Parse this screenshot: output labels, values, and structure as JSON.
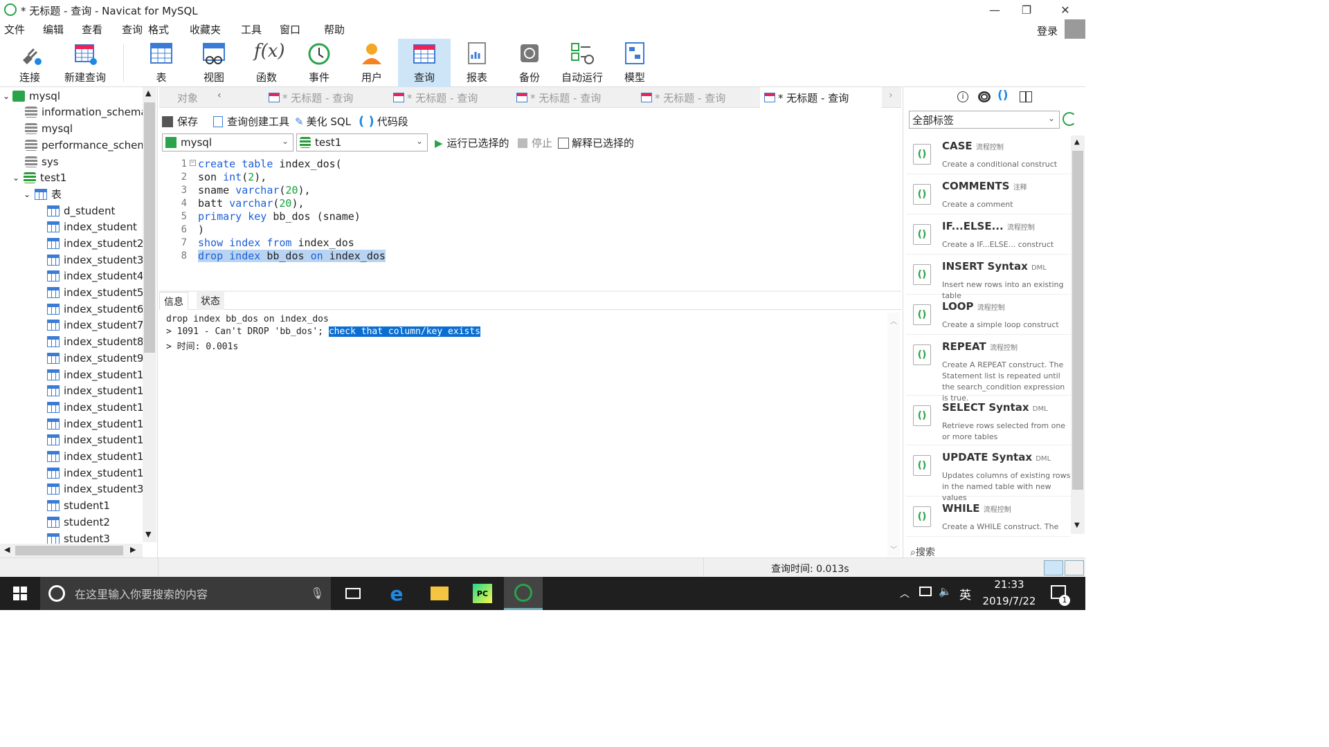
{
  "window": {
    "title": "* 无标题 - 查询 - Navicat for MySQL",
    "minimize": "—",
    "maximize": "❐",
    "close": "✕"
  },
  "menu": {
    "items": [
      "文件",
      "编辑",
      "查看",
      "查询",
      "格式",
      "收藏夹",
      "工具",
      "窗口",
      "帮助"
    ],
    "login": "登录"
  },
  "toolbar": {
    "connect": "连接",
    "new_query": "新建查询",
    "table": "表",
    "view": "视图",
    "function": "函数",
    "event": "事件",
    "user": "用户",
    "query": "查询",
    "report": "报表",
    "backup": "备份",
    "automation": "自动运行",
    "model": "模型"
  },
  "tree": {
    "root": "mysql",
    "databases": [
      "information_schema",
      "mysql",
      "performance_schema",
      "sys"
    ],
    "open_db": "test1",
    "tables_folder": "表",
    "tables": [
      "d_student",
      "index_student",
      "index_student2",
      "index_student3",
      "index_student4",
      "index_student5",
      "index_student6",
      "index_student7",
      "index_student8",
      "index_student9",
      "index_student1(",
      "index_student1:",
      "index_student1:",
      "index_student1·",
      "index_student1!",
      "index_student1(",
      "index_student1:",
      "index_student3:",
      "student1",
      "student2",
      "student3"
    ]
  },
  "tabs": {
    "objects": "对象",
    "items": [
      "* 无标题 - 查询",
      "* 无标题 - 查询",
      "* 无标题 - 查询",
      "* 无标题 - 查询",
      "* 无标题 - 查询"
    ]
  },
  "query_toolbar": {
    "save": "保存",
    "builder": "查询创建工具",
    "beautify": "美化 SQL",
    "snippet": "代码段"
  },
  "selectors": {
    "connection": "mysql",
    "database": "test1",
    "run": "运行已选择的",
    "stop": "停止",
    "explain": "解释已选择的"
  },
  "editor": {
    "line_numbers": [
      "1",
      "2",
      "3",
      "4",
      "5",
      "6",
      "7",
      "8"
    ]
  },
  "result": {
    "tabs": [
      "信息",
      "状态"
    ],
    "line1": "drop index bb_dos on index_dos",
    "line2a": "> 1091 - Can't DROP 'bb_dos'; ",
    "line2b": "check that column/key exists",
    "line3": "> 时间: 0.001s"
  },
  "right_panel": {
    "filter": "全部标签",
    "search": "搜索",
    "snippets": [
      {
        "name": "CASE",
        "tag": "流程控制",
        "desc": "Create a conditional construct"
      },
      {
        "name": "COMMENTS",
        "tag": "注释",
        "desc": "Create a comment"
      },
      {
        "name": "IF...ELSE...",
        "tag": "流程控制",
        "desc": "Create a IF...ELSE... construct"
      },
      {
        "name": "INSERT Syntax",
        "tag": "DML",
        "desc": "Insert new rows into an existing table"
      },
      {
        "name": "LOOP",
        "tag": "流程控制",
        "desc": "Create a simple loop construct"
      },
      {
        "name": "REPEAT",
        "tag": "流程控制",
        "desc": "Create A REPEAT construct. The Statement list is repeated until the search_condition expression is true."
      },
      {
        "name": "SELECT Syntax",
        "tag": "DML",
        "desc": "Retrieve rows selected from one or more tables"
      },
      {
        "name": "UPDATE Syntax",
        "tag": "DML",
        "desc": "Updates columns of existing rows in the named table with new values"
      },
      {
        "name": "WHILE",
        "tag": "流程控制",
        "desc": "Create a WHILE construct. The"
      }
    ]
  },
  "status": {
    "query_time": "查询时间: 0.013s"
  },
  "taskbar": {
    "search_placeholder": "在这里输入你要搜索的内容",
    "time": "21:33",
    "date": "2019/7/22",
    "ime": "英",
    "notif": "1"
  }
}
